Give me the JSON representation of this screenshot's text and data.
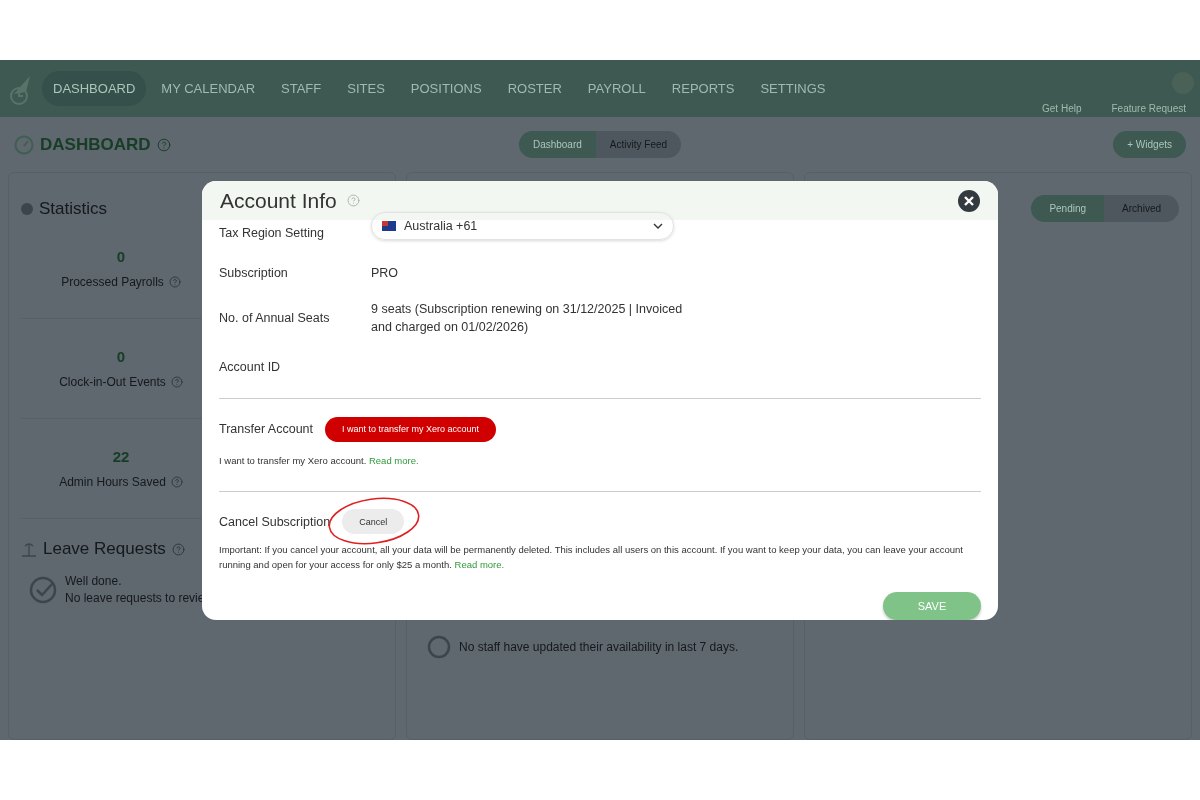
{
  "nav": {
    "items": [
      {
        "label": "DASHBOARD",
        "selected": true
      },
      {
        "label": "MY CALENDAR",
        "selected": false
      },
      {
        "label": "STAFF",
        "selected": false
      },
      {
        "label": "SITES",
        "selected": false
      },
      {
        "label": "POSITIONS",
        "selected": false
      },
      {
        "label": "ROSTER",
        "selected": false
      },
      {
        "label": "PAYROLL",
        "selected": false
      },
      {
        "label": "REPORTS",
        "selected": false
      },
      {
        "label": "SETTINGS",
        "selected": false
      }
    ],
    "links": [
      "Get Help",
      "Feature Request"
    ]
  },
  "header": {
    "title": "DASHBOARD",
    "tabs": [
      {
        "label": "Dashboard",
        "selected": true
      },
      {
        "label": "Activity Feed",
        "selected": false
      }
    ],
    "widgets_button": "+ Widgets"
  },
  "statistics": {
    "title": "Statistics",
    "items": [
      {
        "value": "0",
        "label": "Processed Payrolls"
      },
      {
        "value": "0",
        "label": "Clock-in-Out Events"
      },
      {
        "value": "22",
        "label": "Admin Hours Saved"
      }
    ]
  },
  "leave_requests": {
    "title": "Leave Requests",
    "message": "Well done.",
    "detail": "No leave requests to revie"
  },
  "availability": {
    "message": "No staff have updated their availability in last 7 days."
  },
  "request_tabs": [
    {
      "label": "Pending",
      "selected": true
    },
    {
      "label": "Archived",
      "selected": false
    }
  ],
  "modal": {
    "title": "Account Info",
    "tax_region": {
      "label": "Tax Region Setting",
      "value": "Australia +61"
    },
    "subscription": {
      "label": "Subscription",
      "value": "PRO"
    },
    "seats": {
      "label": "No. of Annual Seats",
      "value": "9 seats (Subscription renewing on 31/12/2025 | Invoiced and charged on 01/02/2026)"
    },
    "account_id": {
      "label": "Account ID"
    },
    "transfer": {
      "label": "Transfer Account",
      "button": "I want to transfer my Xero account",
      "note": "I want to transfer my Xero account.",
      "link": "Read more."
    },
    "cancel": {
      "label": "Cancel Subscription",
      "button": "Cancel",
      "note": "Important: If you cancel your account, all your data will be permanently deleted. This includes all users on this account. If you want to keep your data, you can leave your account running and open for your access for only $25 a month.",
      "link": "Read more."
    },
    "save_button": "SAVE"
  }
}
